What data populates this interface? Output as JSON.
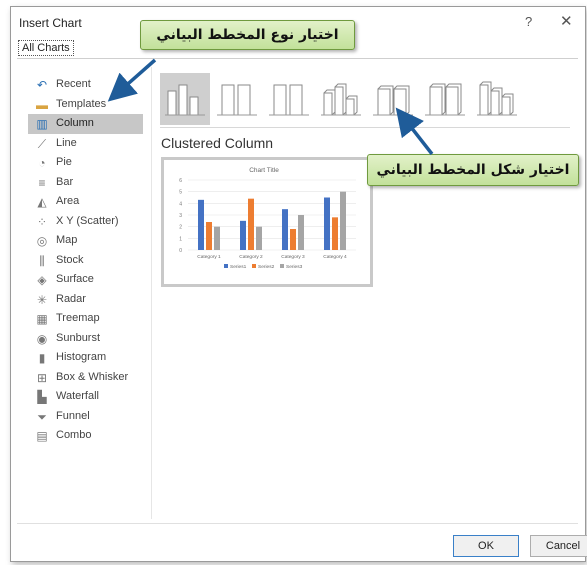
{
  "dialog": {
    "title": "Insert Chart",
    "help_glyph": "?",
    "close_glyph": "✕"
  },
  "tabs": [
    {
      "label": "All Charts"
    }
  ],
  "callouts": {
    "chart_type": "اختيار نوع المخطط البياني",
    "chart_shape": "اختيار شكل المخطط البياني"
  },
  "sidebar": {
    "items": [
      {
        "label": "Recent",
        "icon": "undo-arrow-icon"
      },
      {
        "label": "Templates",
        "icon": "folder-icon"
      },
      {
        "label": "Column",
        "icon": "column-chart-icon",
        "selected": true
      },
      {
        "label": "Line",
        "icon": "line-chart-icon"
      },
      {
        "label": "Pie",
        "icon": "pie-chart-icon"
      },
      {
        "label": "Bar",
        "icon": "bar-chart-icon"
      },
      {
        "label": "Area",
        "icon": "area-chart-icon"
      },
      {
        "label": "X Y (Scatter)",
        "icon": "scatter-chart-icon"
      },
      {
        "label": "Map",
        "icon": "map-chart-icon"
      },
      {
        "label": "Stock",
        "icon": "stock-chart-icon"
      },
      {
        "label": "Surface",
        "icon": "surface-chart-icon"
      },
      {
        "label": "Radar",
        "icon": "radar-chart-icon"
      },
      {
        "label": "Treemap",
        "icon": "treemap-chart-icon"
      },
      {
        "label": "Sunburst",
        "icon": "sunburst-chart-icon"
      },
      {
        "label": "Histogram",
        "icon": "histogram-chart-icon"
      },
      {
        "label": "Box & Whisker",
        "icon": "box-whisker-chart-icon"
      },
      {
        "label": "Waterfall",
        "icon": "waterfall-chart-icon"
      },
      {
        "label": "Funnel",
        "icon": "funnel-chart-icon"
      },
      {
        "label": "Combo",
        "icon": "combo-chart-icon"
      }
    ]
  },
  "subtypes": {
    "selected_index": 0,
    "items": [
      "clustered-column",
      "stacked-column",
      "100-stacked-column",
      "3d-clustered-column",
      "3d-stacked-column",
      "3d-100-stacked-column",
      "3d-column"
    ]
  },
  "preview": {
    "name": "Clustered Column"
  },
  "chart_data": {
    "type": "bar",
    "title": "Chart Title",
    "categories": [
      "Category 1",
      "Category 2",
      "Category 3",
      "Category 4"
    ],
    "series": [
      {
        "name": "Series1",
        "values": [
          4.3,
          2.5,
          3.5,
          4.5
        ],
        "color": "#4472c4"
      },
      {
        "name": "Series2",
        "values": [
          2.4,
          4.4,
          1.8,
          2.8
        ],
        "color": "#ed7d31"
      },
      {
        "name": "Series3",
        "values": [
          2,
          2,
          3,
          5
        ],
        "color": "#a5a5a5"
      }
    ],
    "yticks": [
      "0",
      "1",
      "2",
      "3",
      "4",
      "5",
      "6"
    ],
    "ylim": [
      0,
      6
    ],
    "grid": true,
    "legend": "bottom"
  },
  "buttons": {
    "ok": "OK",
    "cancel": "Cancel"
  },
  "colors": {
    "accent": "#1f5c99",
    "callout_fill": "#c9e4a3",
    "selected": "#c7c7c7"
  }
}
